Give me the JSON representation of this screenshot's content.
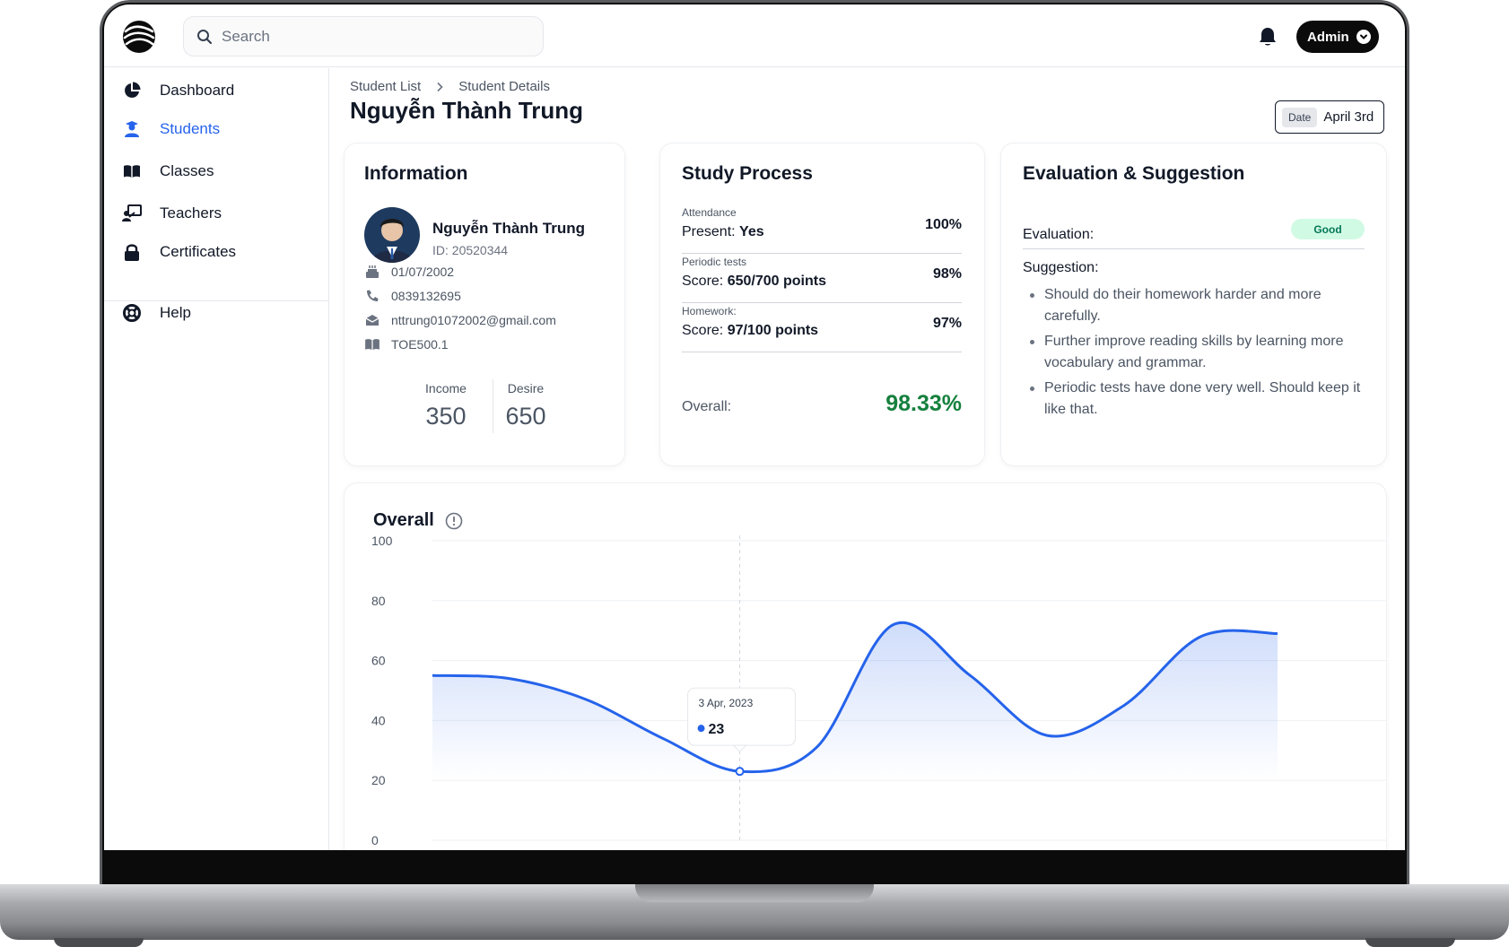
{
  "app": {
    "search_placeholder": "Search",
    "admin_label": "Admin"
  },
  "sidebar": {
    "items": [
      {
        "label": "Dashboard",
        "icon": "pie-chart-icon",
        "active": false
      },
      {
        "label": "Students",
        "icon": "student-icon",
        "active": true
      },
      {
        "label": "Classes",
        "icon": "book-open-icon",
        "active": false
      },
      {
        "label": "Teachers",
        "icon": "teacher-board-icon",
        "active": false
      },
      {
        "label": "Certificates",
        "icon": "lock-icon",
        "active": false
      },
      {
        "label": "Help",
        "icon": "lifebuoy-icon",
        "active": false
      }
    ]
  },
  "breadcrumb": [
    "Student List",
    "Student Details"
  ],
  "page_title": "Nguyễn Thành Trung",
  "date": {
    "label": "Date",
    "value": "April 3rd"
  },
  "information": {
    "title": "Information",
    "name": "Nguyễn Thành Trung",
    "id": "ID: 20520344",
    "birthday": "01/07/2002",
    "phone": "0839132695",
    "email": "nttrung01072002@gmail.com",
    "class": "TOE500.1",
    "income_label": "Income",
    "income_value": "350",
    "desire_label": "Desire",
    "desire_value": "650"
  },
  "study_process": {
    "title": "Study Process",
    "rows": [
      {
        "label": "Attendance",
        "prefix": "Present: ",
        "value": "Yes",
        "percent": "100%"
      },
      {
        "label": "Periodic tests",
        "prefix": "Score: ",
        "value": "650/700 points",
        "percent": "98%"
      },
      {
        "label": "Homework:",
        "prefix": "Score: ",
        "value": "97/100 points",
        "percent": "97%"
      }
    ],
    "overall_label": "Overall:",
    "overall_value": "98.33%"
  },
  "evaluation": {
    "title": "Evaluation & Suggestion",
    "evaluation_label": "Evaluation:",
    "evaluation_badge": "Good",
    "suggestion_label": "Suggestion:",
    "suggestions": [
      "Should do their homework harder and more carefully.",
      "Further improve reading skills by learning more vocabulary and grammar.",
      "Periodic tests have done very well. Should keep it like that."
    ]
  },
  "colors": {
    "accent": "#2563eb",
    "good": "#15803d",
    "badge_bg": "#d1fae5"
  },
  "chart_data": {
    "type": "area",
    "title": "Overall",
    "ylim": [
      0,
      100
    ],
    "yticks": [
      "100",
      "80",
      "60",
      "40",
      "20",
      "0"
    ],
    "series": [
      {
        "values": [
          55,
          54,
          47,
          34,
          23,
          31,
          72,
          55,
          35,
          45,
          68,
          69
        ]
      }
    ],
    "tooltip": {
      "date": "3 Apr, 2023",
      "value": "23"
    },
    "grid": true
  }
}
